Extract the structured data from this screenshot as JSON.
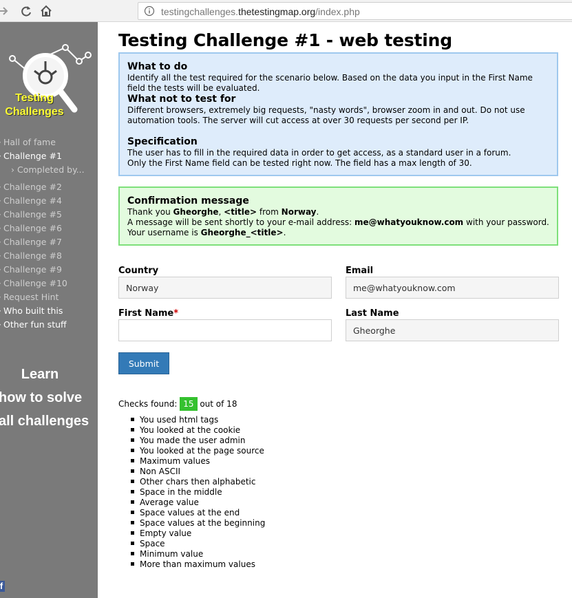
{
  "browser": {
    "url_prefix": "testingchallenges.",
    "url_host": "thetestingmap.org",
    "url_path": "/index.php"
  },
  "sidebar": {
    "logo_line1": "Testing",
    "logo_line2": "Challenges",
    "nav": [
      {
        "label": "Hall of fame"
      },
      {
        "label": "Challenge #1"
      },
      {
        "label": "Completed by..."
      },
      {
        "label": "Challenge #2"
      },
      {
        "label": "Challenge #4"
      },
      {
        "label": "Challenge #5"
      },
      {
        "label": "Challenge #6"
      },
      {
        "label": "Challenge #7"
      },
      {
        "label": "Challenge #8"
      },
      {
        "label": "Challenge #9"
      },
      {
        "label": "Challenge #10"
      },
      {
        "label": "Request Hint"
      },
      {
        "label": "Who built this"
      },
      {
        "label": "Other fun stuff"
      }
    ],
    "learn_line1": "Learn",
    "learn_line2": "how to solve",
    "learn_line3": "all challenges",
    "facebook_glyph": "f"
  },
  "main": {
    "title": "Testing Challenge #1 - web testing",
    "info": {
      "what_to_do_title": "What to do",
      "what_to_do_text": "Identify all the test required for the scenario below. Based on the data you input in the First Name field the tests will be evaluated.",
      "not_test_title": "What not to test for",
      "not_test_text": "Different browsers, extremely big requests, \"nasty words\", browser zoom in and out. Do not use automation tools. The server will cut access at over 30 requests per second per IP.",
      "spec_title": "Specification",
      "spec_line1": "The user has to fill in the required data in order to get access, as a standard user in a forum.",
      "spec_line2": "Only the First Name field can be tested right now. The field has a max length of 30."
    },
    "confirmation": {
      "title": "Confirmation message",
      "l1_a": "Thank you ",
      "l1_name": "Gheorghe",
      "l1_b": ", ",
      "l1_tag": "<title>",
      "l1_c": " from ",
      "l1_country": "Norway",
      "l1_d": ".",
      "l2_a": "A message will be sent shortly to your e-mail address: ",
      "l2_email": "me@whatyouknow.com",
      "l2_b": " with your password.",
      "l3_a": "Your username is ",
      "l3_user": "Gheorghe_<title>",
      "l3_b": "."
    },
    "form": {
      "country_label": "Country",
      "country_value": "Norway",
      "email_label": "Email",
      "email_value": "me@whatyouknow.com",
      "first_name_label": "First Name",
      "required_mark": "*",
      "first_name_value": "",
      "last_name_label": "Last Name",
      "last_name_value": "Gheorghe",
      "submit_label": "Submit"
    },
    "checks": {
      "prefix": "Checks found: ",
      "found": "15",
      "suffix": " out of 18",
      "items": [
        "You used html tags",
        "You looked at the cookie",
        "You made the user admin",
        "You looked at the page source",
        "Maximum values",
        "Non ASCII",
        "Other chars then alphabetic",
        "Space in the middle",
        "Average value",
        "Space values at the end",
        "Space values at the beginning",
        "Empty value",
        "Space",
        "Minimum value",
        "More than maximum values"
      ]
    }
  }
}
